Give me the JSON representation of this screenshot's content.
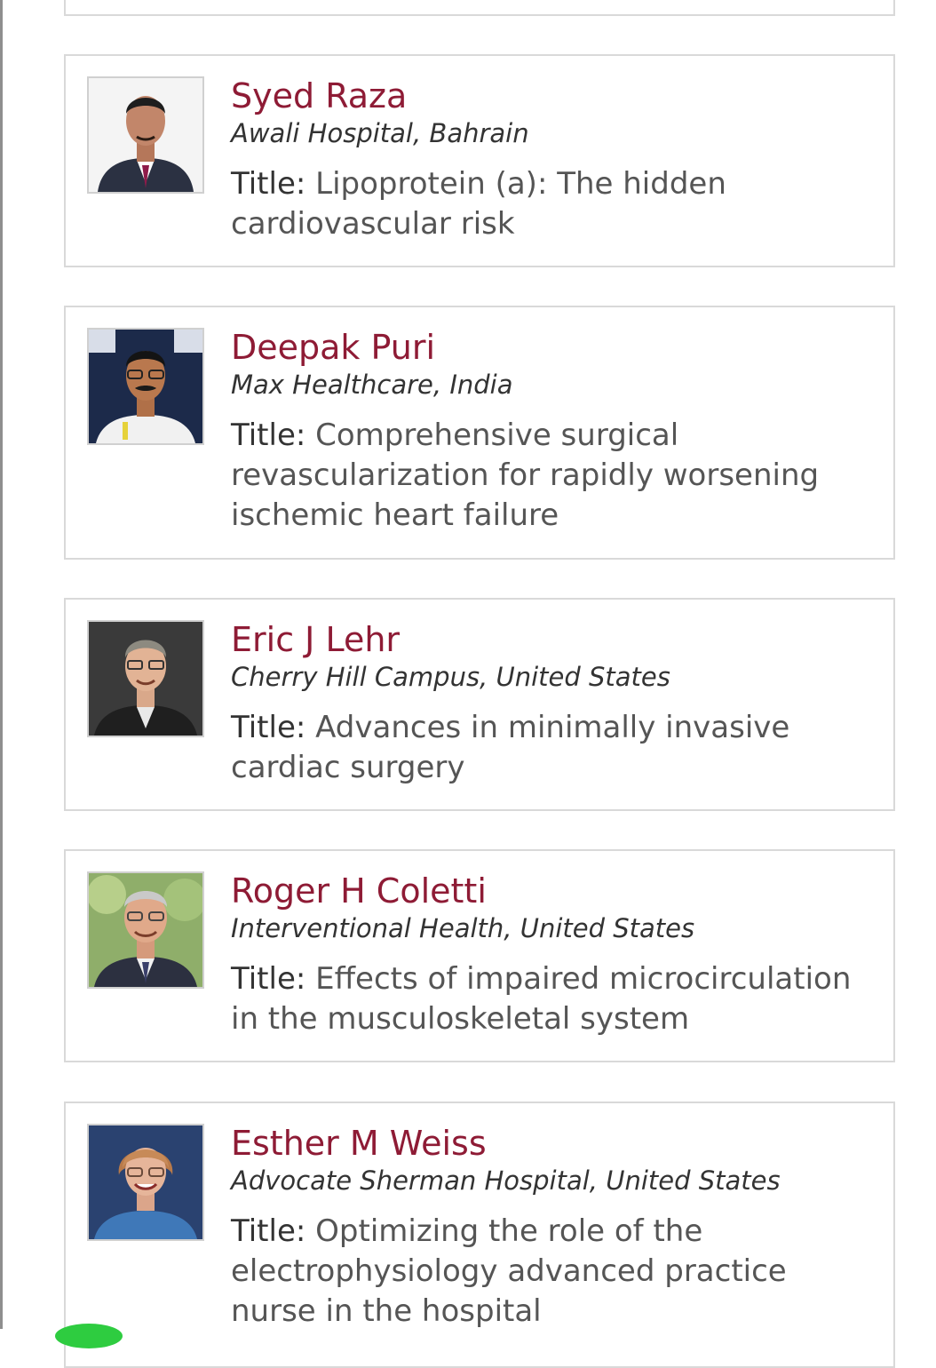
{
  "title_label": "Title:",
  "speakers": [
    {
      "name": "Syed Raza",
      "affiliation": "Awali Hospital, Bahrain",
      "talk_title": "Lipoprotein (a): The hidden cardiovascular risk"
    },
    {
      "name": "Deepak Puri",
      "affiliation": "Max Healthcare, India",
      "talk_title": "Comprehensive surgical revascularization for rapidly worsening ischemic heart failure"
    },
    {
      "name": "Eric J Lehr",
      "affiliation": "Cherry Hill Campus, United States",
      "talk_title": "Advances in minimally invasive cardiac surgery"
    },
    {
      "name": "Roger H Coletti",
      "affiliation": "Interventional Health, United States",
      "talk_title": "Effects of impaired microcirculation in the musculoskeletal system"
    },
    {
      "name": "Esther M Weiss",
      "affiliation": "Advocate Sherman Hospital, United States",
      "talk_title": "Optimizing the role of the electrophysiology advanced practice nurse in the hospital"
    }
  ],
  "colors": {
    "name": "#8e1b35",
    "border": "#d9d9d9",
    "body_text": "#555555"
  }
}
